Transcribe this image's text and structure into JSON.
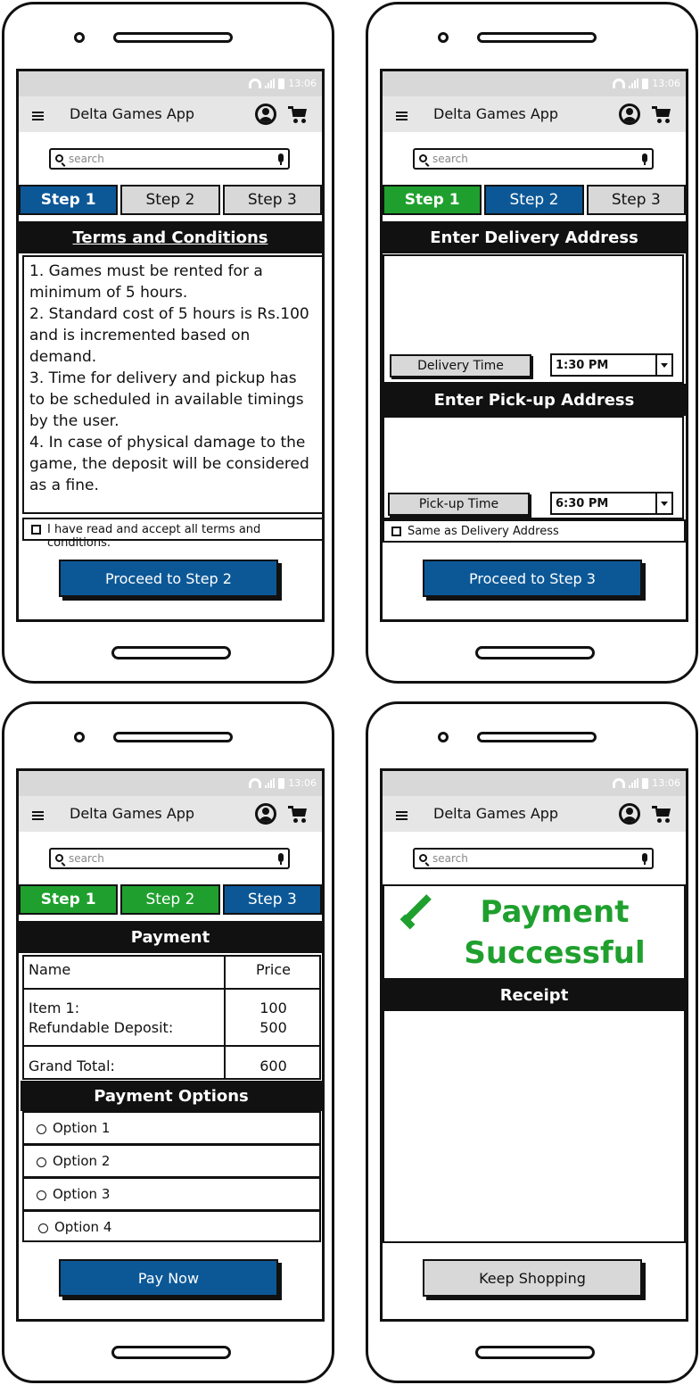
{
  "app": {
    "title": "Delta Games App",
    "status_time": "13:06",
    "search_placeholder": "search",
    "colors": {
      "primary": "#0c5897",
      "success": "#1fa02e",
      "chrome": "#d8d8d8",
      "dark": "#111111"
    }
  },
  "screen1": {
    "steps": [
      "Step 1",
      "Step 2",
      "Step 3"
    ],
    "heading": "Terms and Conditions",
    "terms": [
      "1. Games must be rented for a minimum of 5 hours.",
      "2. Standard cost of 5 hours is Rs.100 and is incremented based on demand.",
      "3. Time for delivery and pickup has to be scheduled in available timings by the user.",
      "4. In case of physical damage to the game, the deposit will be considered as a fine."
    ],
    "accept_label": "I have read and accept all terms and conditions.",
    "proceed_label": "Proceed to Step 2"
  },
  "screen2": {
    "steps": [
      "Step 1",
      "Step 2",
      "Step 3"
    ],
    "delivery_heading": "Enter Delivery Address",
    "delivery_time_label": "Delivery Time",
    "delivery_time_value": "1:30 PM",
    "pickup_heading": "Enter Pick-up Address",
    "pickup_time_label": "Pick-up Time",
    "pickup_time_value": "6:30 PM",
    "same_address_label": "Same as Delivery Address",
    "proceed_label": "Proceed to Step 3"
  },
  "screen3": {
    "steps": [
      "Step 1",
      "Step 2",
      "Step 3"
    ],
    "heading": "Payment",
    "table": {
      "header_name": "Name",
      "header_price": "Price",
      "item_label": "Item 1:",
      "item_price": "100",
      "deposit_label": "Refundable Deposit:",
      "deposit_price": "500",
      "total_label": "Grand Total:",
      "total_price": "600"
    },
    "options_heading": "Payment Options",
    "options": [
      "Option 1",
      "Option 2",
      "Option 3",
      "Option 4"
    ],
    "pay_label": "Pay Now"
  },
  "screen4": {
    "success_line1": "Payment",
    "success_line2": "Successful",
    "receipt_heading": "Receipt",
    "keep_shopping_label": "Keep Shopping"
  }
}
